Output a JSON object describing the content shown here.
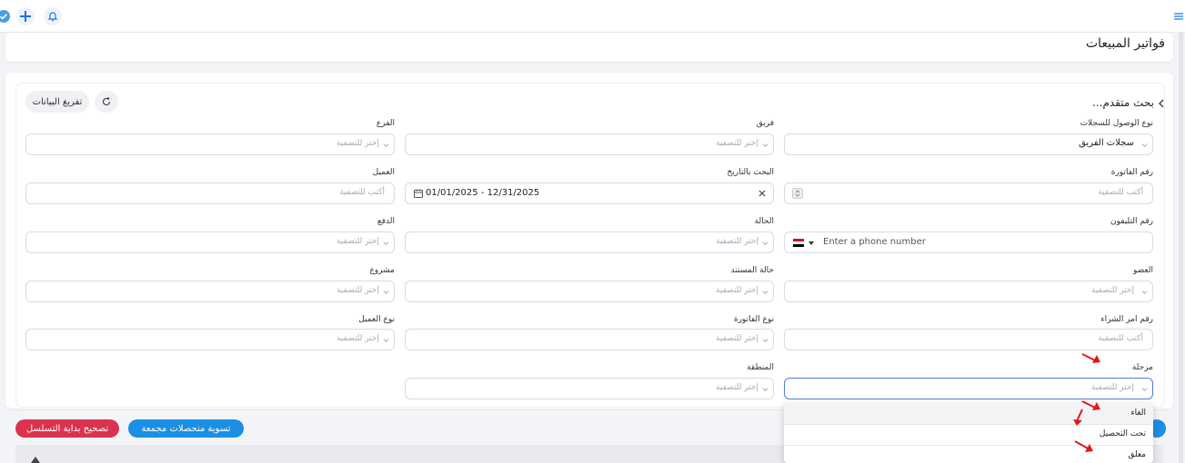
{
  "page": {
    "title": "فواتير المبيعات"
  },
  "toolbar": {
    "icons": [
      "menu-icon",
      "bell-icon",
      "plus-icon",
      "check-badge-icon"
    ]
  },
  "search": {
    "advanced_label": "بحث متقدم...",
    "clear_label": "تفريغ البيانات",
    "refresh_icon": "refresh-icon"
  },
  "filters": {
    "access_type": {
      "label": "نوع الوصول للسجلات",
      "value": "سجلات الفريق"
    },
    "team": {
      "label": "فريق",
      "placeholder": "إختر للتصفية"
    },
    "branch": {
      "label": "الفرع",
      "placeholder": "إختر للتصفية"
    },
    "invoice_no": {
      "label": "رقم الفاتورة",
      "placeholder": "أكتب للتصفية"
    },
    "date_search": {
      "label": "البحث بالتاريخ",
      "value": "01/01/2025 - 12/31/2025"
    },
    "customer": {
      "label": "العميل",
      "placeholder": "أكتب للتصفية"
    },
    "phone": {
      "label": "رقم التليفون",
      "placeholder": "Enter a phone number"
    },
    "status": {
      "label": "الحالة",
      "placeholder": "إختر للتصفية"
    },
    "payment": {
      "label": "الدفع",
      "placeholder": "إختر للتصفية"
    },
    "member": {
      "label": "العضو",
      "placeholder": "إختر للتصفية"
    },
    "document_status": {
      "label": "حالة المستند",
      "placeholder": "إختر للتصفية"
    },
    "project": {
      "label": "مشروع",
      "placeholder": "إختر للتصفية"
    },
    "po_number": {
      "label": "رقم امر الشراء",
      "placeholder": "أكتب للتصفية"
    },
    "invoice_type": {
      "label": "نوع الفاتورة",
      "placeholder": "إختر للتصفية"
    },
    "customer_type": {
      "label": "نوع العميل",
      "placeholder": "إختر للتصفية"
    },
    "stage": {
      "label": "مرحلة",
      "placeholder": "إختر للتصفية"
    },
    "region": {
      "label": "المنطقة",
      "placeholder": "إختر للتصفية"
    }
  },
  "stage_options": [
    "الغاء",
    "تحت التحصيل",
    "معلق"
  ],
  "actions": {
    "bulk_settle": "تسوية متحصلات مجمعة",
    "fix_sequence": "تصحيح بداية التسلسل"
  },
  "colors": {
    "primary": "#1a8fe3",
    "danger": "#d9334e",
    "annotation": "#e01818"
  }
}
